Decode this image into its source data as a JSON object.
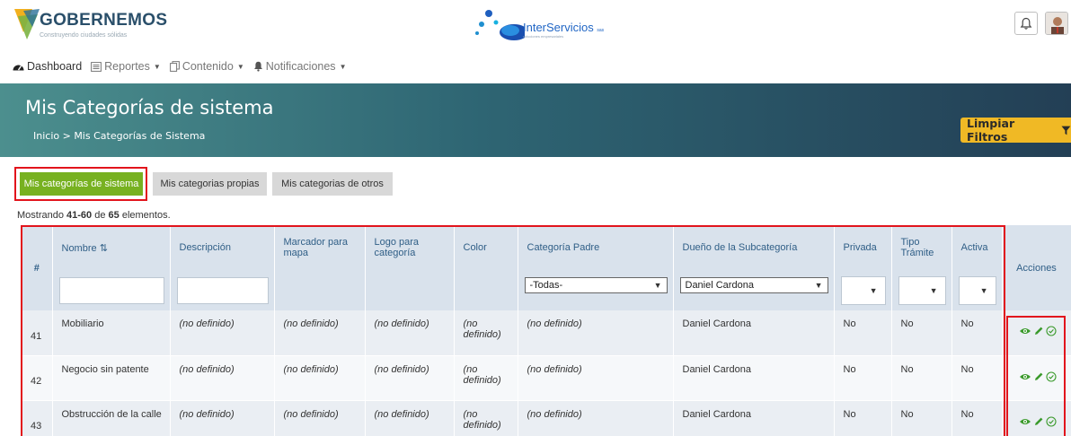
{
  "header": {
    "brand_name": "GOBERNEMOS",
    "brand_tagline": "Construyendo ciudades sólidas",
    "partner_name": "InterServicios",
    "partner_suffix": "sas",
    "partner_tagline": "soluciones empresariales"
  },
  "nav": {
    "items": [
      {
        "label": "Dashboard",
        "icon": "tachometer-icon"
      },
      {
        "label": "Reportes",
        "icon": "report-icon"
      },
      {
        "label": "Contenido",
        "icon": "copy-icon"
      },
      {
        "label": "Notificaciones",
        "icon": "bell-icon"
      }
    ]
  },
  "banner": {
    "title": "Mis Categorías de sistema",
    "breadcrumb": "Inicio >  Mis Categorías de Sistema",
    "clear_filters": "Limpiar Filtros"
  },
  "tabs": [
    {
      "label": "Mis categorías de sistema",
      "active": true
    },
    {
      "label": "Mis categorias propias",
      "active": false
    },
    {
      "label": "Mis categorias de otros",
      "active": false
    }
  ],
  "summary": {
    "prefix": "Mostrando ",
    "range": "41-60",
    "middle": " de ",
    "total": "65",
    "suffix": " elementos."
  },
  "table": {
    "columns": {
      "hash": "#",
      "nombre": "Nombre",
      "descripcion": "Descripción",
      "marcador": "Marcador para mapa",
      "logo": "Logo para categoría",
      "color": "Color",
      "padre": "Categoría Padre",
      "dueno": "Dueño de la Subcategoría",
      "privada": "Privada",
      "tipo": "Tipo Trámite",
      "activa": "Activa",
      "acciones": "Acciones"
    },
    "filters": {
      "padre_selected": "-Todas-",
      "dueno_selected": "Daniel Cardona"
    },
    "rows": [
      {
        "num": "41",
        "nombre": "Mobiliario",
        "descripcion": "(no definido)",
        "marcador": "(no definido)",
        "logo": "(no definido)",
        "color": "(no definido)",
        "padre": "(no definido)",
        "dueno": "Daniel Cardona",
        "privada": "No",
        "tipo": "No",
        "activa": "No"
      },
      {
        "num": "42",
        "nombre": "Negocio sin patente",
        "descripcion": "(no definido)",
        "marcador": "(no definido)",
        "logo": "(no definido)",
        "color": "(no definido)",
        "padre": "(no definido)",
        "dueno": "Daniel Cardona",
        "privada": "No",
        "tipo": "No",
        "activa": "No"
      },
      {
        "num": "43",
        "nombre": "Obstrucción de la calle",
        "descripcion": "(no definido)",
        "marcador": "(no definido)",
        "logo": "(no definido)",
        "color": "(no definido)",
        "padre": "(no definido)",
        "dueno": "Daniel Cardona",
        "privada": "No",
        "tipo": "No",
        "activa": "No"
      }
    ]
  },
  "colors": {
    "accent_green": "#77b120",
    "accent_yellow": "#f0b925",
    "highlight_red": "#e2141c",
    "icon_green": "#3a9a2b"
  }
}
